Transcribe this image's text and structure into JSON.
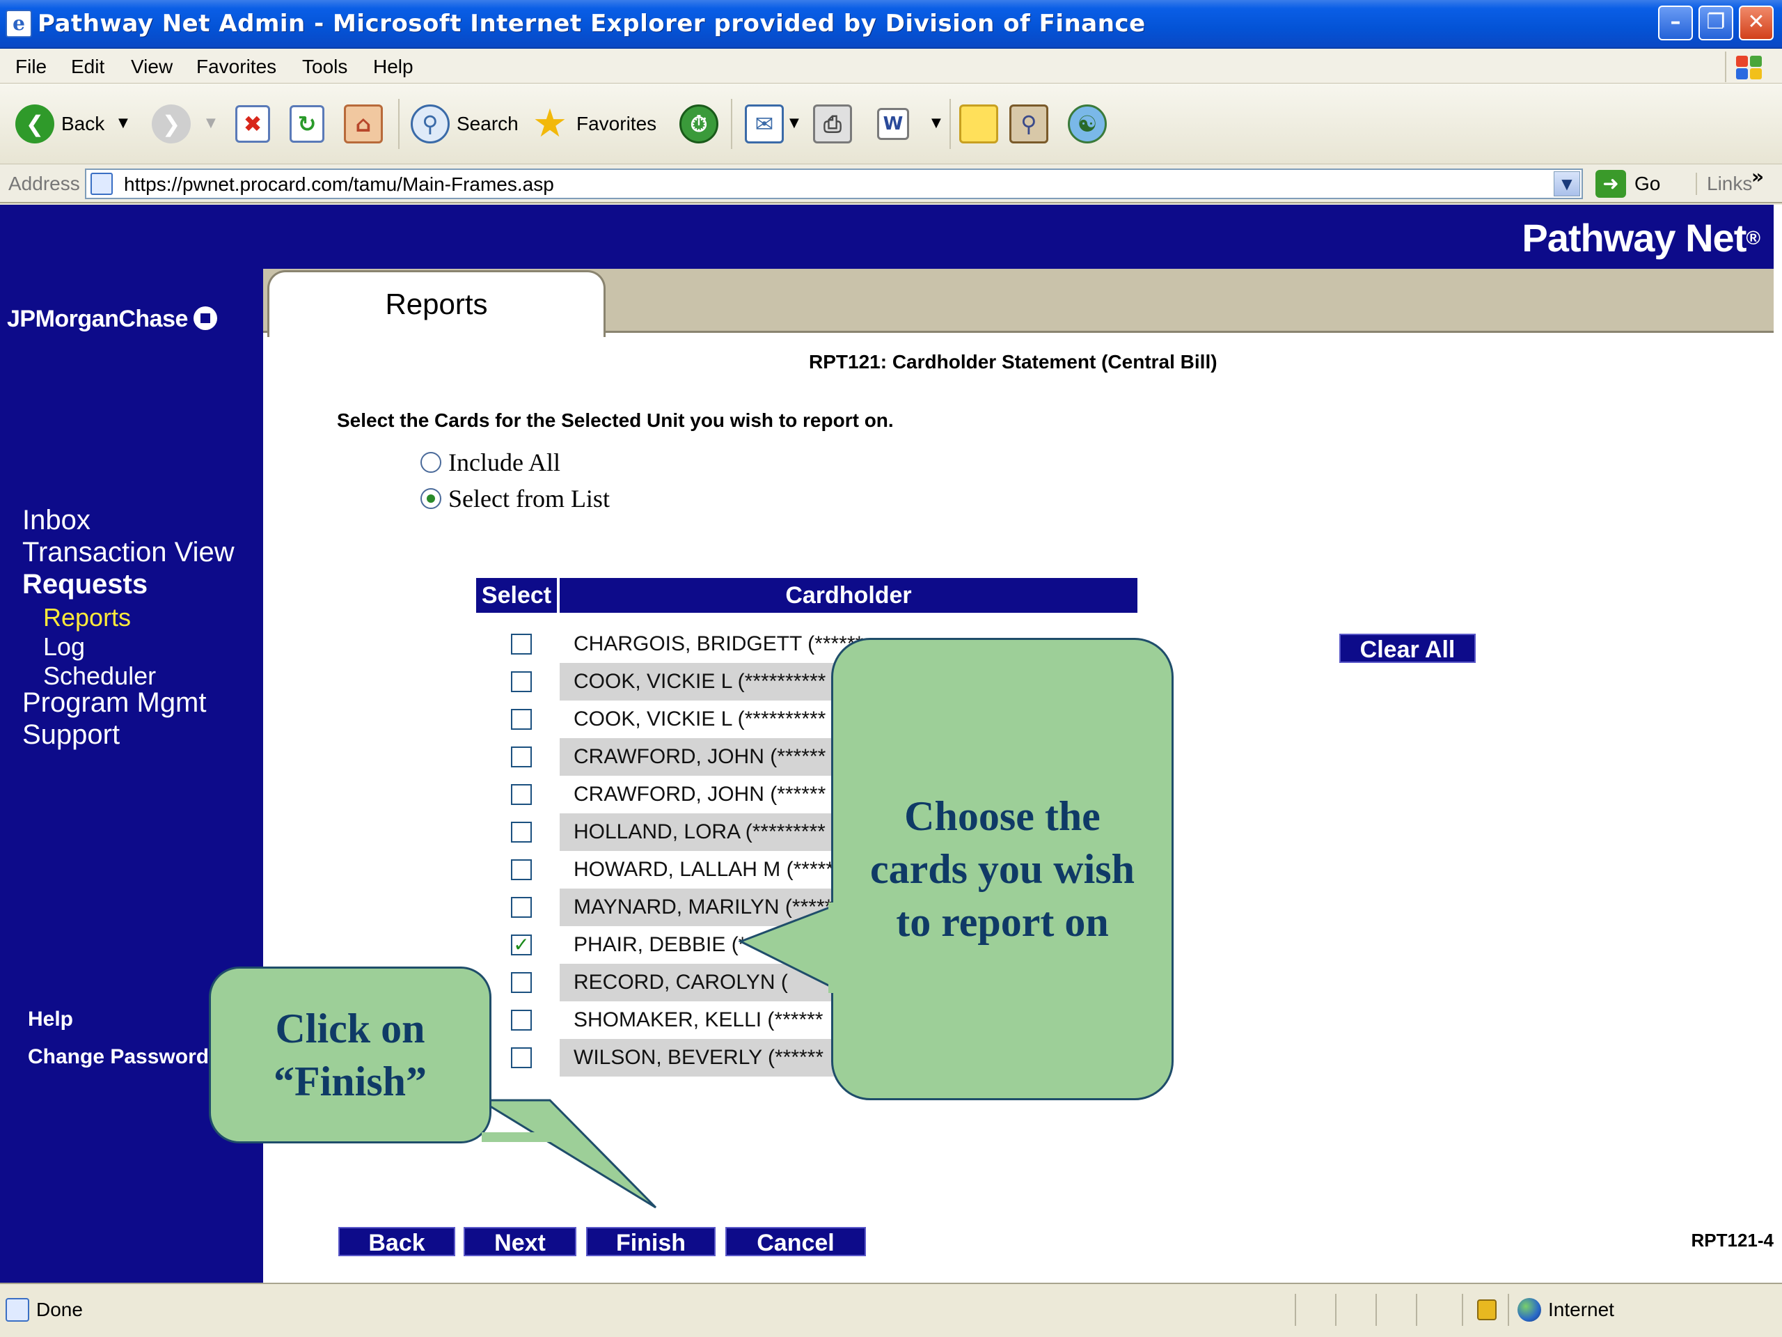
{
  "window": {
    "title": "Pathway Net Admin - Microsoft Internet Explorer provided by Division of Finance",
    "min_glyph": "–",
    "max_glyph": "❐",
    "close_glyph": "✕"
  },
  "menu": [
    "File",
    "Edit",
    "View",
    "Favorites",
    "Tools",
    "Help"
  ],
  "toolbar": {
    "back_label": "Back",
    "search_label": "Search",
    "favorites_label": "Favorites"
  },
  "address": {
    "label": "Address",
    "url": "https://pwnet.procard.com/tamu/Main-Frames.asp",
    "go_label": "Go",
    "links_label": "Links"
  },
  "brand": {
    "product": "Pathway Net",
    "product_mark": "®",
    "bank": "JPMorganChase"
  },
  "sidebar": {
    "items": [
      {
        "label": "Inbox"
      },
      {
        "label": "Transaction View"
      },
      {
        "label": "Requests"
      },
      {
        "label": "Reports"
      },
      {
        "label": "Log"
      },
      {
        "label": "Scheduler"
      },
      {
        "label": "Program Mgmt"
      },
      {
        "label": "Support"
      }
    ],
    "footer": [
      {
        "label": "Help"
      },
      {
        "label": "Change Password"
      }
    ]
  },
  "tab": {
    "label": "Reports"
  },
  "report": {
    "title": "RPT121: Cardholder Statement (Central Bill)",
    "instruction": "Select the Cards for the Selected Unit you wish to report on.",
    "options": [
      {
        "label": "Include All",
        "selected": false
      },
      {
        "label": "Select from List",
        "selected": true
      }
    ],
    "table": {
      "headers": [
        "Select",
        "Cardholder"
      ],
      "rows": [
        {
          "name": "CHARGOIS, BRIDGETT (******",
          "checked": false
        },
        {
          "name": "COOK, VICKIE L (**********",
          "checked": false
        },
        {
          "name": "COOK, VICKIE L (**********",
          "checked": false
        },
        {
          "name": "CRAWFORD, JOHN (******",
          "checked": false
        },
        {
          "name": "CRAWFORD, JOHN (******",
          "checked": false
        },
        {
          "name": "HOLLAND, LORA (*********",
          "checked": false
        },
        {
          "name": "HOWARD, LALLAH M (*****",
          "checked": false
        },
        {
          "name": "MAYNARD, MARILYN (*****",
          "checked": false
        },
        {
          "name": "PHAIR, DEBBIE (*",
          "checked": true
        },
        {
          "name": "RECORD, CAROLYN (",
          "checked": false
        },
        {
          "name": "SHOMAKER, KELLI (******",
          "checked": false
        },
        {
          "name": "WILSON, BEVERLY (******",
          "checked": false
        }
      ]
    },
    "clear_all_label": "Clear All",
    "buttons": {
      "back": "Back",
      "next": "Next",
      "finish": "Finish",
      "cancel": "Cancel"
    },
    "page_id": "RPT121-4"
  },
  "callouts": {
    "choose": "Choose the cards you wish to report on",
    "finish": "Click on “Finish”"
  },
  "status": {
    "text": "Done",
    "zone": "Internet"
  },
  "colors": {
    "brand_navy": "#0d0b8a",
    "active_nav": "#ffea3a",
    "callout_fill": "#9dcf98",
    "callout_text": "#0f3a66"
  },
  "icons": {
    "back": "back-arrow-icon",
    "forward": "forward-arrow-icon",
    "stop": "stop-icon",
    "refresh": "refresh-icon",
    "home": "home-icon",
    "search": "search-icon",
    "favorites": "star-icon",
    "history": "history-icon",
    "mail": "mail-icon",
    "print": "print-icon",
    "edit": "word-edit-icon",
    "discuss": "note-icon",
    "research": "research-icon",
    "messenger": "messenger-icon"
  }
}
